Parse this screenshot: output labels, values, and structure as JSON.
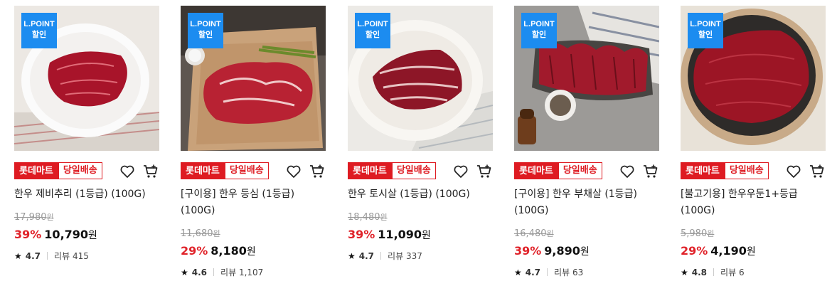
{
  "badge": {
    "line1": "L.POINT",
    "line2": "할인"
  },
  "tags": {
    "mart": "롯데마트",
    "delivery": "당일배송"
  },
  "icons": {
    "wishlist": "heart-icon",
    "cart": "cart-icon",
    "rating": "star-icon"
  },
  "colors": {
    "accent": "#de1b22",
    "badge_blue": "#1c8cf0",
    "discount": "#e0232a"
  },
  "currency": "원",
  "review_label": "리뷰",
  "products": [
    {
      "name": "한우 제비추리 (1등급) (100G)",
      "original_price": "17,980",
      "discount_rate": "39%",
      "sale_price": "10,790",
      "rating": "4.7",
      "reviews": "415"
    },
    {
      "name": "[구이용] 한우 등심 (1등급) (100G)",
      "original_price": "11,680",
      "discount_rate": "29%",
      "sale_price": "8,180",
      "rating": "4.6",
      "reviews": "1,107"
    },
    {
      "name": "한우 토시살 (1등급) (100G)",
      "original_price": "18,480",
      "discount_rate": "39%",
      "sale_price": "11,090",
      "rating": "4.7",
      "reviews": "337"
    },
    {
      "name": "[구이용] 한우 부채살 (1등급) (100G)",
      "original_price": "16,480",
      "discount_rate": "39%",
      "sale_price": "9,890",
      "rating": "4.7",
      "reviews": "63"
    },
    {
      "name": "[불고기용] 한우우둔1+등급 (100G)",
      "original_price": "5,980",
      "discount_rate": "29%",
      "sale_price": "4,190",
      "rating": "4.8",
      "reviews": "6"
    }
  ]
}
